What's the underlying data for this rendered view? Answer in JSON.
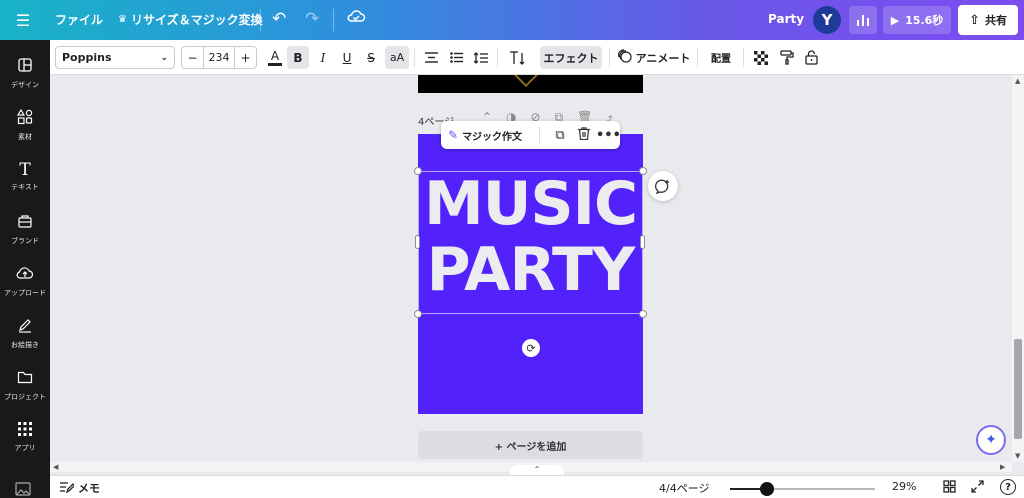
{
  "topbar": {
    "file_label": "ファイル",
    "resize_label": "リサイズ＆マジック変換",
    "doc_title": "Party",
    "avatar_initial": "Y",
    "play_time": "15.6秒",
    "share_label": "共有"
  },
  "sidebar": {
    "items": [
      {
        "label": "デザイン",
        "icon": "design-icon"
      },
      {
        "label": "素材",
        "icon": "elements-icon"
      },
      {
        "label": "テキスト",
        "icon": "text-icon"
      },
      {
        "label": "ブランド",
        "icon": "brand-icon"
      },
      {
        "label": "アップロード",
        "icon": "upload-icon"
      },
      {
        "label": "お絵描き",
        "icon": "draw-icon"
      },
      {
        "label": "プロジェクト",
        "icon": "folder-icon"
      },
      {
        "label": "アプリ",
        "icon": "apps-icon"
      }
    ]
  },
  "toolbar": {
    "font_name": "Poppins",
    "font_size": "234",
    "effect_label": "エフェクト",
    "animate_label": "アニメート",
    "position_label": "配置"
  },
  "canvas": {
    "page_label": "4ページ -",
    "floating_magic_label": "マジック作文",
    "text_line1": "MUSIC",
    "text_line2": "PARTY",
    "page_bg_color": "#5221fb",
    "add_page_label": "+ ページを追加"
  },
  "bottombar": {
    "notes_label": "メモ",
    "page_count": "4/4ページ",
    "zoom_percent": 29,
    "zoom_label": "29%"
  }
}
